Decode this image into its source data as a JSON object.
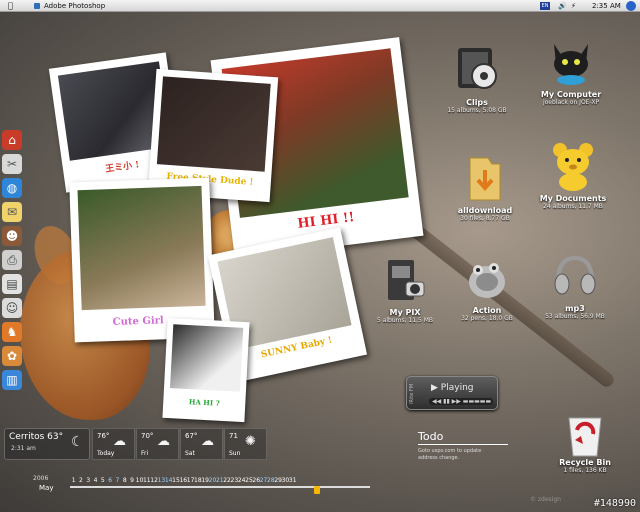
{
  "menubar": {
    "app_name": "Adobe Photoshop",
    "clock": "2:35 AM",
    "lang": "EN"
  },
  "photos": [
    {
      "caption": "王ミ小 !",
      "caption_color": "#d03a2a"
    },
    {
      "caption": "Free Style Dude !",
      "caption_color": "#e6b400"
    },
    {
      "caption": "HI HI !!",
      "caption_color": "#e0202a"
    },
    {
      "caption": "Cute Girl ~",
      "caption_color": "#d46ad6"
    },
    {
      "caption": "SUNNY Baby !",
      "caption_color": "#e6a800"
    },
    {
      "caption": "HA HI ?",
      "caption_color": "#2aa838"
    }
  ],
  "desktop_icons": [
    {
      "label": "Clips",
      "sub": "15 albums, 5.08 GB",
      "icon": "film-strip-icon"
    },
    {
      "label": "My Computer",
      "sub": "joeblack on JOE-XP",
      "icon": "black-cat-icon"
    },
    {
      "label": "alldownload",
      "sub": "30 files, 8.77 GB",
      "icon": "folder-download-icon"
    },
    {
      "label": "My Documents",
      "sub": "24 albums, 11.7 MB",
      "icon": "yellow-bear-icon"
    },
    {
      "label": "My PIX",
      "sub": "5 albums, 11.5 MB",
      "icon": "camera-icon"
    },
    {
      "label": "Action",
      "sub": "32 pens, 18.0 GB",
      "icon": "gimp-icon"
    },
    {
      "label": "mp3",
      "sub": "53 albums, 56.9 MB",
      "icon": "headphones-icon"
    }
  ],
  "weather": {
    "city": "Cerritos",
    "temp": "63°",
    "time": "2:31 am",
    "forecast": [
      {
        "temp": "76°",
        "day": "Today"
      },
      {
        "temp": "70°",
        "day": "Fri"
      },
      {
        "temp": "67°",
        "day": "Sat"
      },
      {
        "temp": "71",
        "day": "Sun"
      }
    ]
  },
  "calendar": {
    "year": "2006",
    "month": "May",
    "days": [
      "1",
      "2",
      "3",
      "4",
      "5",
      "6",
      "7",
      "8",
      "9",
      "10",
      "11",
      "12",
      "13",
      "14",
      "15",
      "16",
      "17",
      "18",
      "19",
      "20",
      "21",
      "22",
      "23",
      "24",
      "25",
      "26",
      "27",
      "28",
      "29",
      "30",
      "31"
    ]
  },
  "player": {
    "status": "Playing",
    "brand": "iRite FM"
  },
  "todo": {
    "title": "Todo",
    "note": "Goto usps.com to update address change."
  },
  "recycle": {
    "label": "Recycle Bin",
    "sub": "1 files, 136 KB"
  },
  "watermark": "#148990",
  "watermark_faint": "© zdesign"
}
